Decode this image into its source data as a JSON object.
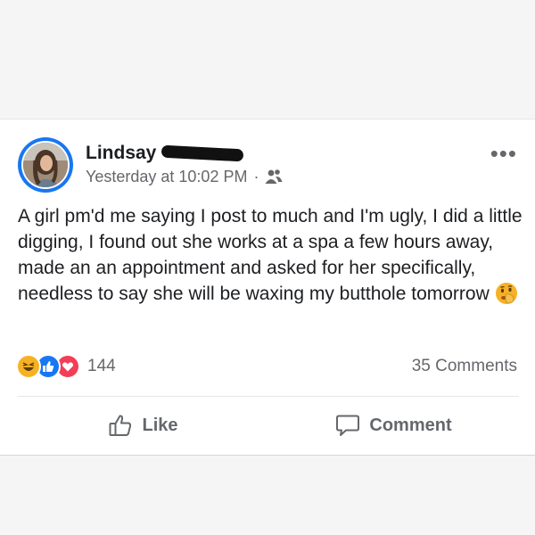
{
  "post": {
    "author_name": "Lindsay",
    "timestamp": "Yesterday at 10:02 PM",
    "separator": "·",
    "audience_icon": "friends-icon",
    "body_text": "A girl pm'd me saying I post to much and I'm ugly, I did a little digging, I found out she works at a spa a few hours away, made an an appointment and asked for her specifically, needless to say she will be waxing my butthole tomorrow",
    "body_emoji": "shushing-face-emoji"
  },
  "reactions": {
    "types": [
      "haha",
      "like",
      "love"
    ],
    "count": "144",
    "comments_label": "35 Comments"
  },
  "actions": {
    "like_label": "Like",
    "comment_label": "Comment"
  },
  "colors": {
    "brand_blue": "#1877f2",
    "love_red": "#f33e58",
    "haha_yellow": "#f7b125",
    "secondary_text": "#65676b",
    "primary_text": "#1c1e21"
  }
}
